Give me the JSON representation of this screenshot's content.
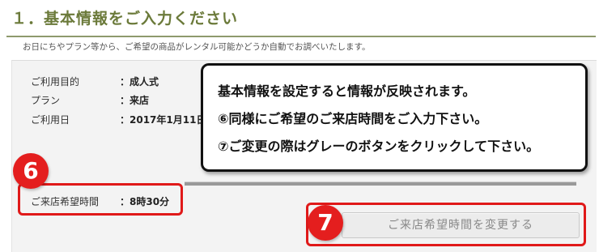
{
  "header": {
    "title": "１．基本情報をご入力ください",
    "subtitle": "お日にちやプラン等から、ご希望の商品がレンタル可能かどうか自動でお調べいたします。"
  },
  "info": {
    "purpose": {
      "label": "ご利用目的",
      "colon": "：",
      "value": "成人式"
    },
    "plan": {
      "label": "プラン",
      "colon": "：",
      "value": "来店"
    },
    "date": {
      "label": "ご利用日",
      "colon": "：",
      "value": "2017年1月11日"
    },
    "visit_time": {
      "label": "ご来店希望時間",
      "colon": "：",
      "value": "8時30分"
    }
  },
  "callout": {
    "line1": "基本情報を設定すると情報が反映されます。",
    "line2": "⑥同様にご希望のご来店時間をご入力下さい。",
    "line3": "⑦ご変更の際はグレーのボタンをクリックして下さい。"
  },
  "badges": {
    "six": "6",
    "seven": "7"
  },
  "change_button": {
    "label": "ご来店希望時間を変更する"
  },
  "colors": {
    "header_text": "#6b7a3a",
    "highlight_red": "#e01919",
    "badge_red": "#e41e1e",
    "panel_bg": "#f3f3f3"
  }
}
